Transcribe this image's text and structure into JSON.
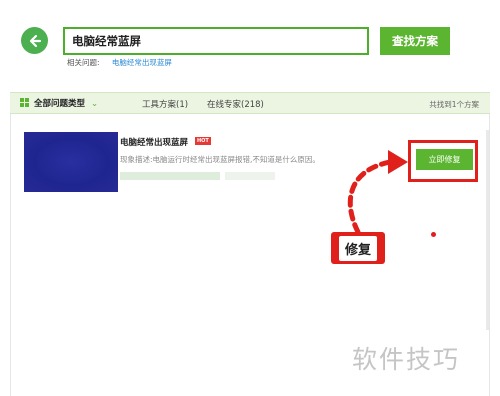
{
  "search": {
    "value": "电脑经常蓝屏",
    "button_label": "查找方案"
  },
  "related": {
    "label": "相关问题:",
    "link": "电脑经常出现蓝屏"
  },
  "tabs": {
    "all": "全部问题类型",
    "tools": "工具方案(1)",
    "experts": "在线专家(218)",
    "found_text": "共找到1个方案"
  },
  "result": {
    "title": "电脑经常出现蓝屏",
    "badge": "HOT",
    "description": "现象描述:电脑运行时经常出现蓝屏报错,不知道是什么原因。",
    "repair_button": "立即修复"
  },
  "annotation": {
    "label": "修复"
  },
  "watermark": "软件技巧",
  "colors": {
    "accent_green": "#5cb531",
    "highlight_red": "#e0201b",
    "link_blue": "#2d8ad3"
  },
  "icons": {
    "back": "back-arrow-icon",
    "category": "grid-icon",
    "dropdown": "chevron-down-icon"
  }
}
